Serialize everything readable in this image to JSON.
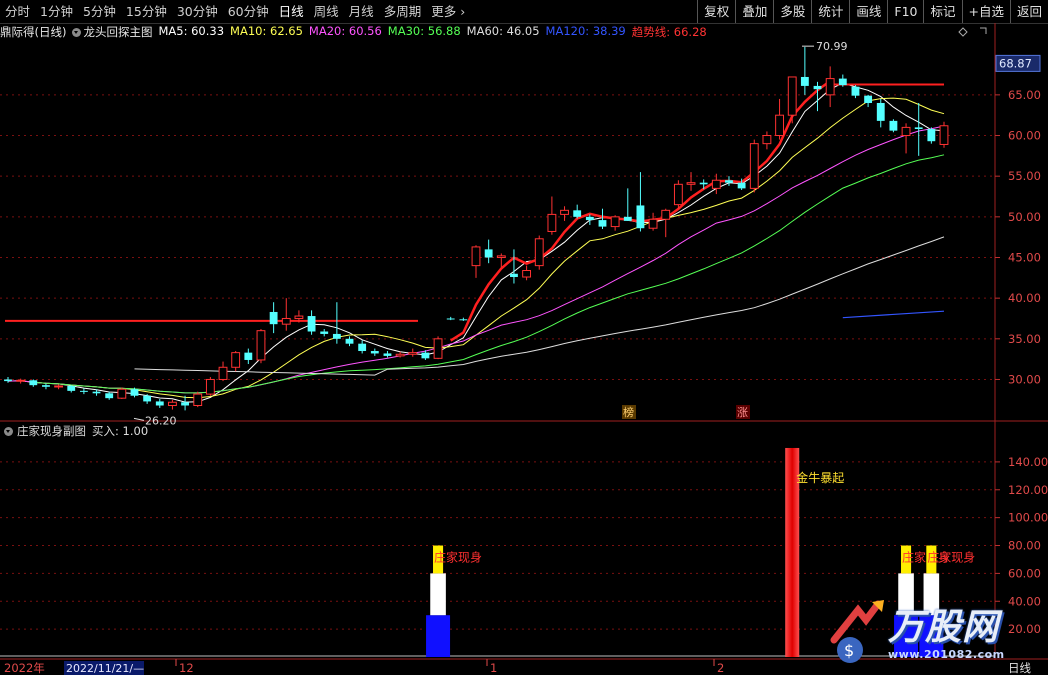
{
  "toolbar": {
    "left_items": [
      "分时",
      "1分钟",
      "5分钟",
      "15分钟",
      "30分钟",
      "60分钟",
      "日线",
      "周线",
      "月线",
      "多周期",
      "更多"
    ],
    "active": "日线",
    "right_buttons": [
      "复权",
      "叠加",
      "多股",
      "统计",
      "画线",
      "F10",
      "标记",
      "+自选",
      "返回"
    ]
  },
  "main_legend": {
    "stock": "鼎际得(日线)",
    "indicator": "龙头回探主图",
    "items": [
      {
        "label": "MA5: 60.33",
        "color": "#ffffff"
      },
      {
        "label": "MA10: 62.65",
        "color": "#ffff55"
      },
      {
        "label": "MA20: 60.56",
        "color": "#ff55ff"
      },
      {
        "label": "MA30: 56.88",
        "color": "#55ff55"
      },
      {
        "label": "MA60: 46.05",
        "color": "#dddddd"
      },
      {
        "label": "MA120: 38.39",
        "color": "#3355ff"
      },
      {
        "label": "趋势线: 66.28",
        "color": "#ff3333"
      }
    ]
  },
  "sub_legend": {
    "title": "庄家现身副图",
    "value": "买入: 1.00"
  },
  "price_axis": {
    "current": "68.87",
    "ticks": [
      "65.00",
      "60.00",
      "55.00",
      "50.00",
      "45.00",
      "40.00",
      "35.00",
      "30.00"
    ]
  },
  "sub_axis": {
    "ticks": [
      "140.00",
      "120.00",
      "100.00",
      "80.00",
      "60.00",
      "40.00",
      "20.00"
    ]
  },
  "annotations": {
    "high": "70.99",
    "low": "26.20",
    "bang": "榜",
    "zhang": "涨",
    "jinniu": "金牛暴起",
    "zhuangjia": "庄家现身"
  },
  "time_axis": {
    "year": "2022年",
    "date": "2022/11/21/—",
    "m12": "12",
    "m1": "1",
    "m2": "2",
    "period": "日线"
  },
  "watermark": {
    "text": "万股网",
    "url": "www.201082.com"
  },
  "colors": {
    "up": "#ff3232",
    "down": "#54ffff",
    "red_line": "#ff2020",
    "grid": "#7a1010"
  },
  "chart_data": {
    "type": "candlestick",
    "candles": [
      [
        30.0,
        30.3,
        29.6,
        29.8
      ],
      [
        29.8,
        30.1,
        29.5,
        29.9
      ],
      [
        29.9,
        30.0,
        29.1,
        29.3
      ],
      [
        29.3,
        29.5,
        28.8,
        29.1
      ],
      [
        29.1,
        29.4,
        28.8,
        29.2
      ],
      [
        29.2,
        29.3,
        28.4,
        28.6
      ],
      [
        28.6,
        28.9,
        28.2,
        28.5
      ],
      [
        28.5,
        28.8,
        28.0,
        28.3
      ],
      [
        28.3,
        28.5,
        27.5,
        27.7
      ],
      [
        27.7,
        29.0,
        27.6,
        28.8
      ],
      [
        28.8,
        29.0,
        27.8,
        28.0
      ],
      [
        28.0,
        28.2,
        27.0,
        27.3
      ],
      [
        27.3,
        27.6,
        26.5,
        26.8
      ],
      [
        26.8,
        27.5,
        26.3,
        27.2
      ],
      [
        27.2,
        28.0,
        26.2,
        26.8
      ],
      [
        26.8,
        28.5,
        26.6,
        28.2
      ],
      [
        28.2,
        30.3,
        28.0,
        30.0
      ],
      [
        30.0,
        32.2,
        29.8,
        31.5
      ],
      [
        31.5,
        33.5,
        31.0,
        33.3
      ],
      [
        33.3,
        33.8,
        31.9,
        32.4
      ],
      [
        32.4,
        36.2,
        32.0,
        36.0
      ],
      [
        38.3,
        39.5,
        35.7,
        36.8
      ],
      [
        36.8,
        40.0,
        36.0,
        37.5
      ],
      [
        37.5,
        38.5,
        37.0,
        37.8
      ],
      [
        37.8,
        38.5,
        35.5,
        35.9
      ],
      [
        35.9,
        36.2,
        35.3,
        35.6
      ],
      [
        35.6,
        39.5,
        34.4,
        35.0
      ],
      [
        35.0,
        35.3,
        34.1,
        34.4
      ],
      [
        34.4,
        34.8,
        33.2,
        33.5
      ],
      [
        33.5,
        33.8,
        32.9,
        33.2
      ],
      [
        33.2,
        33.5,
        32.7,
        32.9
      ],
      [
        32.9,
        33.4,
        32.7,
        33.1
      ],
      [
        33.1,
        33.8,
        32.8,
        33.3
      ],
      [
        33.3,
        33.6,
        32.4,
        32.6
      ],
      [
        32.6,
        35.3,
        32.5,
        35.0
      ],
      [
        37.5,
        37.7,
        37.3,
        37.4
      ],
      [
        37.4,
        37.6,
        37.2,
        37.3
      ],
      [
        44.0,
        46.5,
        42.5,
        46.3
      ],
      [
        46.0,
        47.2,
        44.3,
        45.0
      ],
      [
        45.0,
        45.5,
        43.8,
        45.2
      ],
      [
        43.0,
        46.0,
        41.8,
        42.6
      ],
      [
        42.6,
        44.0,
        42.2,
        43.4
      ],
      [
        44.0,
        47.7,
        43.5,
        47.3
      ],
      [
        48.2,
        52.5,
        47.8,
        50.3
      ],
      [
        50.3,
        51.3,
        49.5,
        50.8
      ],
      [
        50.8,
        51.5,
        49.8,
        50.0
      ],
      [
        50.0,
        50.3,
        49.0,
        49.6
      ],
      [
        49.6,
        51.0,
        48.5,
        48.8
      ],
      [
        48.8,
        50.2,
        48.3,
        50.0
      ],
      [
        50.0,
        53.5,
        49.5,
        49.5
      ],
      [
        51.4,
        55.5,
        48.2,
        48.6
      ],
      [
        48.6,
        50.5,
        48.3,
        49.7
      ],
      [
        49.7,
        51.0,
        47.5,
        50.8
      ],
      [
        51.5,
        54.5,
        51.0,
        54.0
      ],
      [
        54.0,
        55.5,
        53.2,
        54.2
      ],
      [
        54.2,
        54.6,
        53.4,
        54.0
      ],
      [
        53.5,
        55.3,
        52.8,
        54.5
      ],
      [
        54.5,
        55.0,
        53.8,
        54.2
      ],
      [
        54.2,
        54.7,
        53.3,
        53.5
      ],
      [
        53.5,
        59.5,
        53.0,
        59.0
      ],
      [
        59.0,
        60.5,
        58.3,
        60.0
      ],
      [
        60.0,
        64.5,
        59.5,
        62.5
      ],
      [
        62.5,
        67.0,
        61.5,
        67.2
      ],
      [
        67.2,
        70.9,
        65.0,
        66.1
      ],
      [
        66.1,
        66.6,
        63.0,
        65.7
      ],
      [
        65.0,
        68.5,
        63.5,
        67.0
      ],
      [
        67.0,
        67.5,
        66.0,
        66.2
      ],
      [
        66.0,
        66.2,
        64.6,
        64.9
      ],
      [
        64.9,
        65.0,
        63.5,
        64.0
      ],
      [
        64.0,
        64.5,
        61.0,
        61.8
      ],
      [
        61.8,
        62.0,
        60.4,
        60.6
      ],
      [
        60.0,
        61.5,
        57.8,
        61.0
      ],
      [
        61.0,
        64.0,
        57.5,
        60.8
      ],
      [
        60.8,
        61.0,
        59.0,
        59.3
      ],
      [
        58.9,
        61.7,
        58.5,
        61.2
      ]
    ],
    "ma_series": [
      {
        "name": "MA5",
        "color": "#ffffff"
      },
      {
        "name": "MA10",
        "color": "#ffff55"
      },
      {
        "name": "MA20",
        "color": "#ff55ff"
      },
      {
        "name": "MA30",
        "color": "#55ff55"
      },
      {
        "name": "MA60",
        "color": "#dddddd"
      },
      {
        "name": "MA120",
        "color": "#3355ff"
      }
    ],
    "ylim": [
      26,
      71.5
    ],
    "sub_chart": {
      "type": "bar",
      "events": [
        {
          "index": 34,
          "value": 80,
          "label": "庄家现身"
        },
        {
          "index": 62,
          "value": 150,
          "label": "金牛暴起"
        },
        {
          "index": 71,
          "value": 80,
          "label": "庄家现身"
        },
        {
          "index": 73,
          "value": 80,
          "label": "庄家现身"
        }
      ],
      "ylim": [
        0,
        155
      ]
    }
  }
}
